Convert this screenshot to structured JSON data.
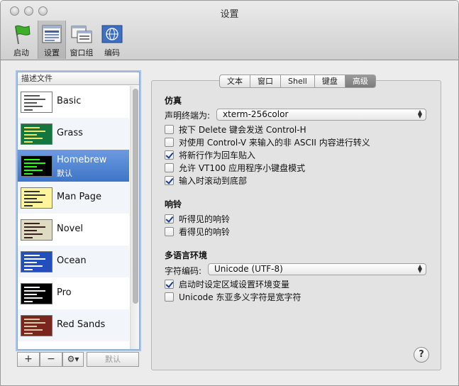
{
  "window": {
    "title": "设置"
  },
  "toolbar": {
    "items": [
      {
        "label": "启动",
        "icon": "green-flag-icon"
      },
      {
        "label": "设置",
        "icon": "settings-window-icon",
        "selected": true
      },
      {
        "label": "窗口组",
        "icon": "window-groups-icon"
      },
      {
        "label": "编码",
        "icon": "encoding-globe-icon"
      }
    ]
  },
  "profiles": {
    "header": "描述文件",
    "items": [
      {
        "name": "Basic",
        "thumb_bg": "#ffffff",
        "thumb_fg": "#555555"
      },
      {
        "name": "Grass",
        "thumb_bg": "#13773d",
        "thumb_fg": "#f2e46b"
      },
      {
        "name": "Homebrew",
        "sub": "默认",
        "thumb_bg": "#000000",
        "thumb_fg": "#28fe14",
        "selected": true
      },
      {
        "name": "Man Page",
        "thumb_bg": "#fef49c",
        "thumb_fg": "#333333"
      },
      {
        "name": "Novel",
        "thumb_bg": "#dfdbc3",
        "thumb_fg": "#3b2322"
      },
      {
        "name": "Ocean",
        "thumb_bg": "#224fbc",
        "thumb_fg": "#ffffff"
      },
      {
        "name": "Pro",
        "thumb_bg": "#000000",
        "thumb_fg": "#f2f2f2"
      },
      {
        "name": "Red Sands",
        "thumb_bg": "#7a251e",
        "thumb_fg": "#d7c9a7"
      }
    ],
    "buttons": {
      "add": "+",
      "remove": "−",
      "gear": "⚙▾",
      "default": "默认"
    }
  },
  "tabs": [
    {
      "label": "文本"
    },
    {
      "label": "窗口"
    },
    {
      "label": "Shell"
    },
    {
      "label": "键盘"
    },
    {
      "label": "高级",
      "active": true
    }
  ],
  "emulation": {
    "title": "仿真",
    "declare_label": "声明终端为:",
    "declare_value": "xterm-256color",
    "options": [
      {
        "label": "按下 Delete 键会发送 Control-H",
        "checked": false
      },
      {
        "label": "对使用 Control-V 来输入的非 ASCII 内容进行转义",
        "checked": false
      },
      {
        "label": "将新行作为回车贴入",
        "checked": true
      },
      {
        "label": "允许 VT100 应用程序小键盘模式",
        "checked": false
      },
      {
        "label": "输入时滚动到底部",
        "checked": true
      }
    ]
  },
  "bell": {
    "title": "响铃",
    "options": [
      {
        "label": "听得见的响铃",
        "checked": true
      },
      {
        "label": "看得见的响铃",
        "checked": false
      }
    ]
  },
  "international": {
    "title": "多语言环境",
    "encoding_label": "字符编码:",
    "encoding_value": "Unicode (UTF-8)",
    "options": [
      {
        "label": "启动时设定区域设置环境变量",
        "checked": true
      },
      {
        "label": "Unicode 东亚多义字符是宽字符",
        "checked": false
      }
    ]
  },
  "help": {
    "label": "?"
  }
}
